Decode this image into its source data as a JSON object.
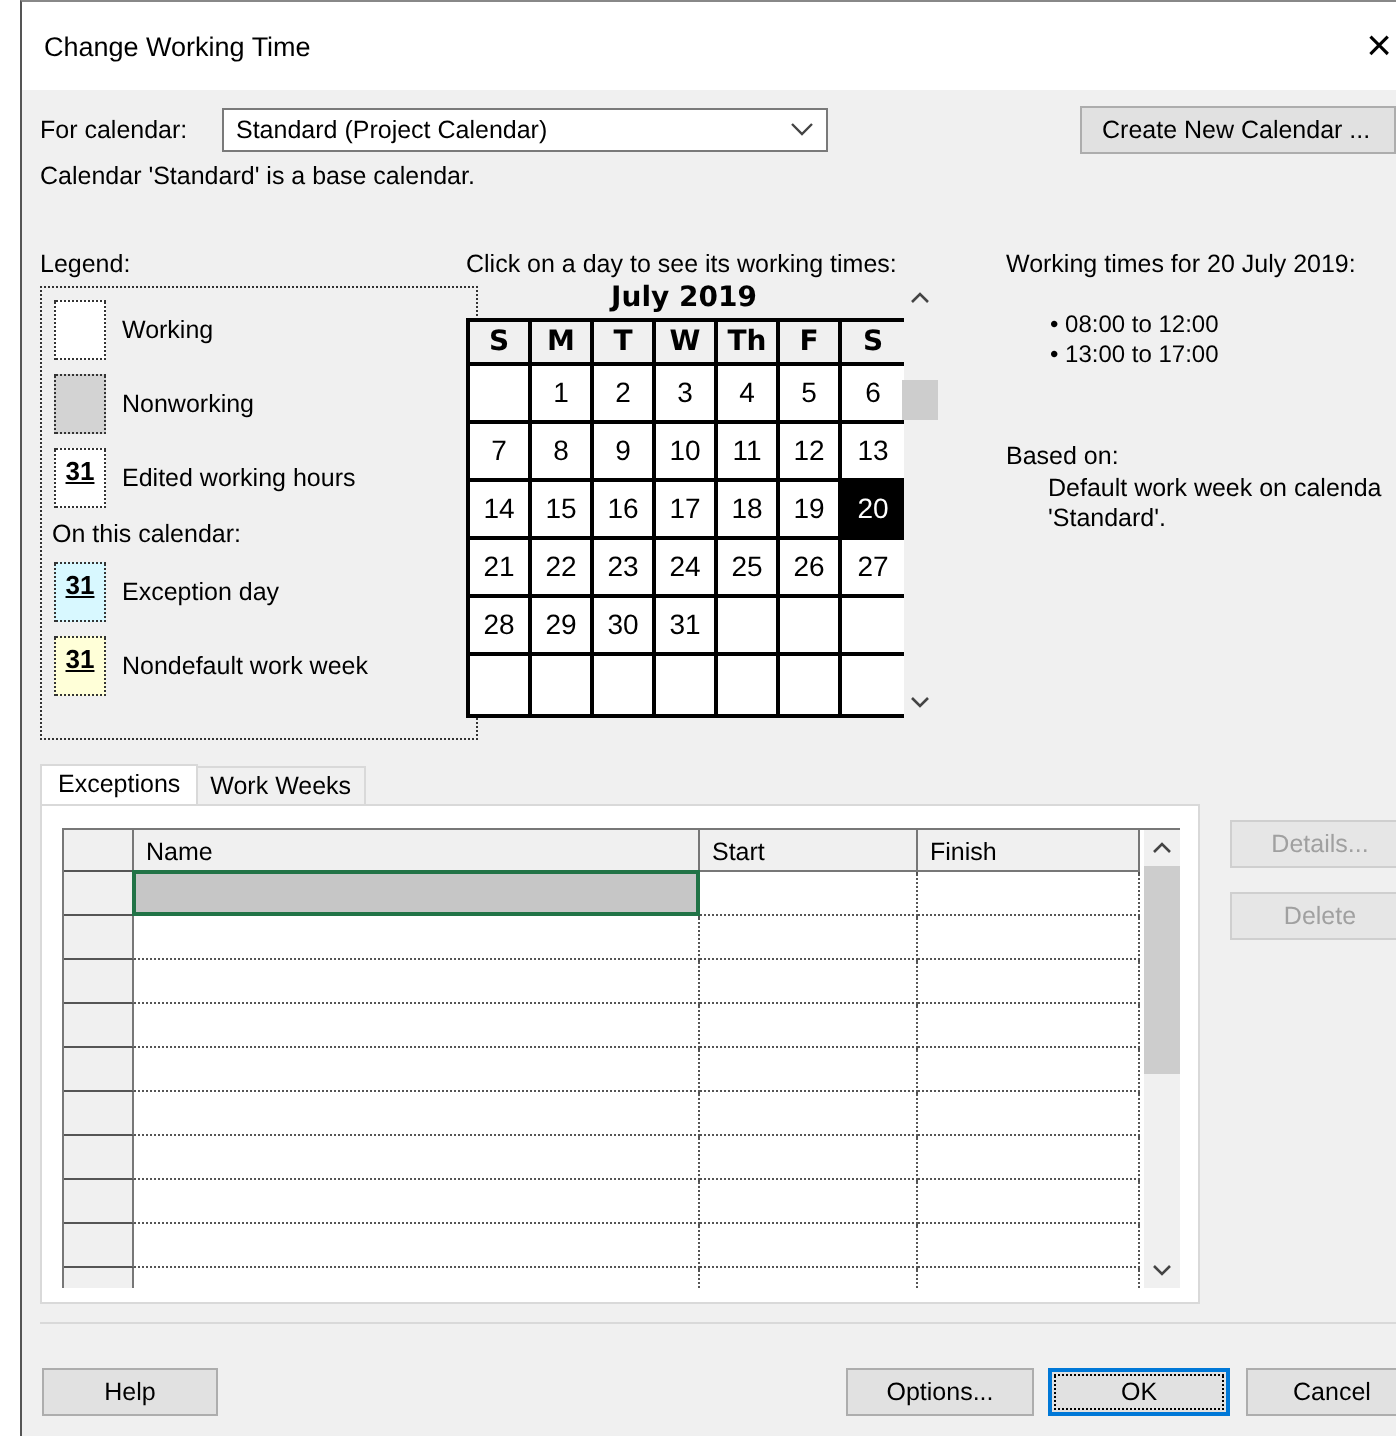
{
  "window": {
    "title": "Change Working Time",
    "close": "×"
  },
  "for_calendar": {
    "label": "For calendar:",
    "value": "Standard (Project Calendar)"
  },
  "create_button": "Create New Calendar ...",
  "base_note": "Calendar 'Standard' is a base calendar.",
  "legend": {
    "title": "Legend:",
    "subheading": "On this calendar:",
    "items": [
      {
        "kind": "working",
        "label": "Working"
      },
      {
        "kind": "nonworking",
        "label": "Nonworking"
      },
      {
        "kind": "edited",
        "sample": "31",
        "label": "Edited working hours"
      },
      {
        "kind": "exception",
        "sample": "31",
        "label": "Exception day"
      },
      {
        "kind": "nondefault",
        "sample": "31",
        "label": "Nondefault work week"
      }
    ]
  },
  "calendar": {
    "prompt": "Click on a day to see its working times:",
    "month": "July 2019",
    "weekdays": [
      "S",
      "M",
      "T",
      "W",
      "Th",
      "F",
      "S"
    ],
    "weeks": [
      [
        {
          "kind": "blank"
        },
        {
          "day": "1",
          "selected": false
        },
        {
          "day": "2",
          "selected": false
        },
        {
          "day": "3",
          "selected": false
        },
        {
          "day": "4",
          "selected": false
        },
        {
          "day": "5",
          "selected": false
        },
        {
          "day": "6",
          "selected": false
        }
      ],
      [
        {
          "day": "7",
          "selected": false
        },
        {
          "day": "8",
          "selected": false
        },
        {
          "day": "9",
          "selected": false
        },
        {
          "day": "10",
          "selected": false
        },
        {
          "day": "11",
          "selected": false
        },
        {
          "day": "12",
          "selected": false
        },
        {
          "day": "13",
          "selected": false
        }
      ],
      [
        {
          "day": "14",
          "selected": false
        },
        {
          "day": "15",
          "selected": false
        },
        {
          "day": "16",
          "selected": false
        },
        {
          "day": "17",
          "selected": false
        },
        {
          "day": "18",
          "selected": false
        },
        {
          "day": "19",
          "selected": false
        },
        {
          "day": "20",
          "selected": true
        }
      ],
      [
        {
          "day": "21",
          "selected": false
        },
        {
          "day": "22",
          "selected": false
        },
        {
          "day": "23",
          "selected": false
        },
        {
          "day": "24",
          "selected": false
        },
        {
          "day": "25",
          "selected": false
        },
        {
          "day": "26",
          "selected": false
        },
        {
          "day": "27",
          "selected": false
        }
      ],
      [
        {
          "day": "28",
          "selected": false
        },
        {
          "day": "29",
          "selected": false
        },
        {
          "day": "30",
          "selected": false
        },
        {
          "day": "31",
          "selected": false
        },
        {
          "kind": "blank"
        },
        {
          "kind": "blank"
        },
        {
          "kind": "blank"
        }
      ],
      [
        {
          "kind": "blank"
        },
        {
          "kind": "blank"
        },
        {
          "kind": "blank"
        },
        {
          "kind": "blank"
        },
        {
          "kind": "blank"
        },
        {
          "kind": "blank"
        },
        {
          "kind": "blank"
        }
      ]
    ]
  },
  "working_times": {
    "title": "Working times for 20 July 2019:",
    "times": [
      "• 08:00 to 12:00",
      "• 13:00 to 17:00"
    ],
    "based_on_label": "Based on:",
    "based_on": "Default work week on calenda",
    "based_on_2": "'Standard'."
  },
  "tabs": [
    {
      "label": "Exceptions",
      "selected": true
    },
    {
      "label": "Work Weeks",
      "selected": false
    }
  ],
  "exceptions": {
    "columns": [
      "Name",
      "Start",
      "Finish"
    ],
    "rows": [
      {
        "selected": true
      },
      {
        "selected": false
      },
      {
        "selected": false
      },
      {
        "selected": false
      },
      {
        "selected": false
      },
      {
        "selected": false
      },
      {
        "selected": false
      },
      {
        "selected": false
      },
      {
        "selected": false
      },
      {
        "selected": false
      }
    ]
  },
  "side_buttons": [
    {
      "label": "Details...",
      "disabled": true
    },
    {
      "label": "Delete",
      "disabled": true
    }
  ],
  "footer": {
    "help": "Help",
    "buttons": [
      {
        "label": "Options...",
        "default": false
      },
      {
        "label": "OK",
        "default": true
      },
      {
        "label": "Cancel",
        "default": false
      }
    ]
  }
}
